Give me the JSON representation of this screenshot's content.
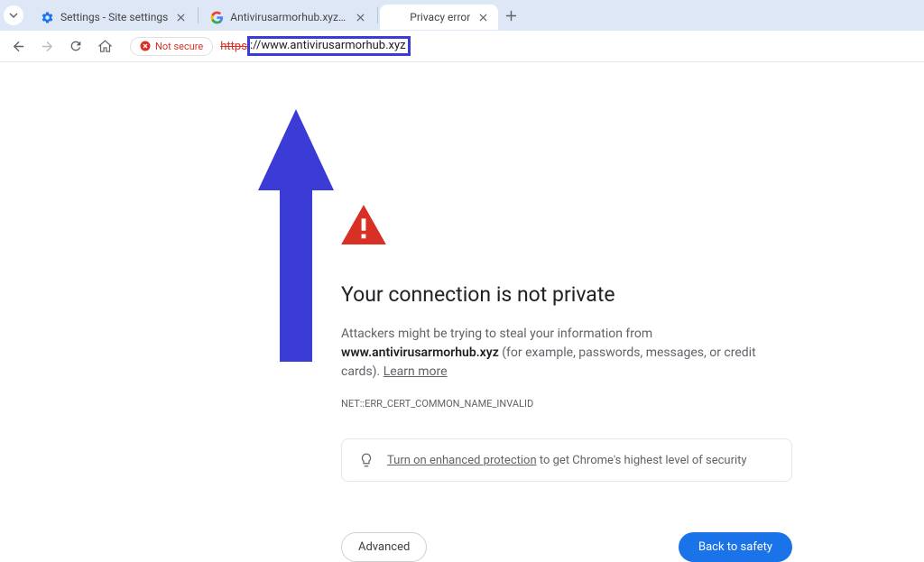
{
  "tabs": [
    {
      "title": "Settings - Site settings",
      "favicon": "gear-blue"
    },
    {
      "title": "Antivirusarmorhub.xyz - Google",
      "favicon": "google-g"
    },
    {
      "title": "Privacy error",
      "favicon": "blank",
      "active": true
    }
  ],
  "addressbar": {
    "security_label": "Not secure",
    "url_protocol": "https",
    "url_rest": "://www.antivirusarmorhub.xyz"
  },
  "error": {
    "title": "Your connection is not private",
    "desc_prefix": "Attackers might be trying to steal your information from ",
    "desc_bold": "www.antivirusarmorhub.xyz",
    "desc_suffix": " (for example, passwords, messages, or credit cards). ",
    "learn_more": "Learn more",
    "code": "NET::ERR_CERT_COMMON_NAME_INVALID",
    "banner_link": "Turn on enhanced protection",
    "banner_rest": " to get Chrome's highest level of security",
    "btn_advanced": "Advanced",
    "btn_primary": "Back to safety"
  }
}
